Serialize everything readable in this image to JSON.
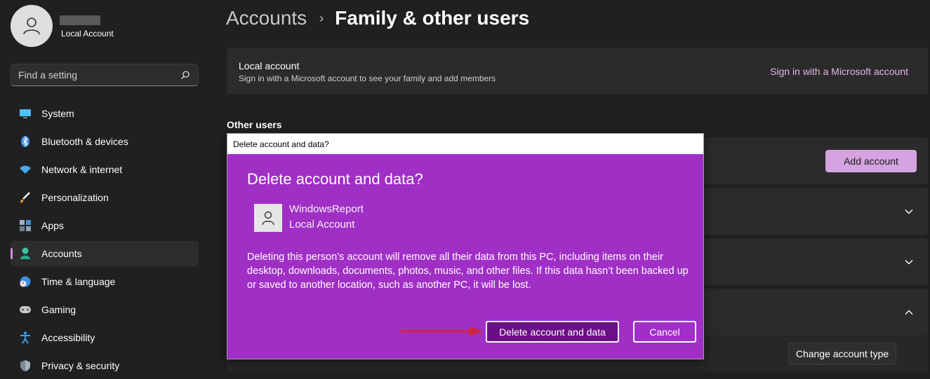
{
  "profile": {
    "account_type": "Local Account"
  },
  "search": {
    "placeholder": "Find a setting"
  },
  "sidebar": {
    "items": [
      {
        "label": "System",
        "icon": "monitor-icon"
      },
      {
        "label": "Bluetooth & devices",
        "icon": "bluetooth-icon"
      },
      {
        "label": "Network & internet",
        "icon": "wifi-icon"
      },
      {
        "label": "Personalization",
        "icon": "brush-icon"
      },
      {
        "label": "Apps",
        "icon": "apps-icon"
      },
      {
        "label": "Accounts",
        "icon": "accounts-icon",
        "active": true
      },
      {
        "label": "Time & language",
        "icon": "globe-clock-icon"
      },
      {
        "label": "Gaming",
        "icon": "gamepad-icon"
      },
      {
        "label": "Accessibility",
        "icon": "accessibility-icon"
      },
      {
        "label": "Privacy & security",
        "icon": "shield-icon"
      }
    ]
  },
  "breadcrumb": {
    "parent": "Accounts",
    "separator": "›",
    "current": "Family & other users"
  },
  "local_account": {
    "title": "Local account",
    "subtitle": "Sign in with a Microsoft account to see your family and add members",
    "link": "Sign in with a Microsoft account"
  },
  "other_users": {
    "label": "Other users",
    "add_button": "Add account"
  },
  "change_account_type": "Change account type",
  "dialog": {
    "titlebar": "Delete account and data?",
    "heading": "Delete account and data?",
    "user_name": "WindowsReport",
    "user_type": "Local Account",
    "body": "Deleting this person’s account will remove all their data from this PC, including items on their desktop, downloads, documents, photos, music, and other files. If this data hasn’t been backed up or saved to another location, such as another PC, it will be lost.",
    "primary_button": "Delete account and data",
    "cancel_button": "Cancel"
  },
  "colors": {
    "background": "#202020",
    "accent": "#d28ad8",
    "dialog_bg": "#a02fc6",
    "primary_button_bg": "#6a0f84",
    "arrow": "#d0243a"
  }
}
